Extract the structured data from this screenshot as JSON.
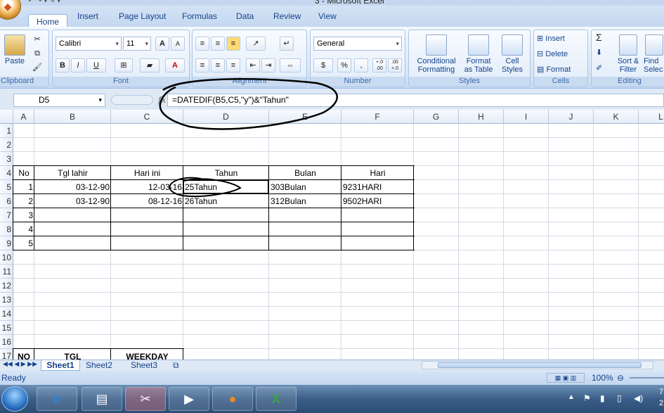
{
  "window": {
    "title": "3 - Microsoft Excel"
  },
  "tabs": [
    "Home",
    "Insert",
    "Page Layout",
    "Formulas",
    "Data",
    "Review",
    "View"
  ],
  "ribbon": {
    "clipboard": {
      "label": "Clipboard",
      "paste": "Paste"
    },
    "font": {
      "label": "Font",
      "name": "Calibri",
      "size": "11",
      "bold": "B",
      "italic": "I",
      "underline": "U",
      "grow": "A",
      "shrink": "A"
    },
    "alignment": {
      "label": "Alignment"
    },
    "number": {
      "label": "Number",
      "format": "General",
      "currency": "$",
      "percent": "%",
      "comma": ",",
      "inc_dec": "+.0 .00",
      "dec_dec": ".00 +.0"
    },
    "styles": {
      "label": "Styles",
      "conditional": "Conditional",
      "conditional2": "Formatting",
      "format_table": "Format",
      "format_table2": "as Table",
      "cell_styles": "Cell",
      "cell_styles2": "Styles"
    },
    "cells": {
      "label": "Cells",
      "insert": "Insert",
      "delete": "Delete",
      "format": "Format"
    },
    "editing": {
      "label": "Editing",
      "sum": "Σ",
      "sort": "Sort &",
      "sort2": "Filter",
      "find": "Find",
      "find2": "Selec"
    }
  },
  "formula_bar": {
    "name_box": "D5",
    "fx": "fx",
    "formula": "=DATEDIF(B5,C5,\"y\")&\"Tahun\""
  },
  "columns": [
    "A",
    "B",
    "C",
    "D",
    "E",
    "F",
    "G",
    "H",
    "I",
    "J",
    "K",
    "L"
  ],
  "rows": [
    "1",
    "2",
    "3",
    "4",
    "5",
    "6",
    "7",
    "8",
    "9",
    "10",
    "11",
    "12",
    "13",
    "14",
    "15",
    "16",
    "17"
  ],
  "table": {
    "headers": [
      "No",
      "Tgl lahir",
      "Hari ini",
      "Tahun",
      "Bulan",
      "Hari"
    ],
    "rows": [
      [
        "1",
        "03-12-90",
        "12-03-16",
        "25Tahun",
        "303Bulan",
        "9231HARI"
      ],
      [
        "2",
        "03-12-90",
        "08-12-16",
        "26Tahun",
        "312Bulan",
        "9502HARI"
      ],
      [
        "3",
        "",
        "",
        "",
        "",
        ""
      ],
      [
        "4",
        "",
        "",
        "",
        "",
        ""
      ],
      [
        "5",
        "",
        "",
        "",
        "",
        ""
      ]
    ]
  },
  "row17": [
    "NO",
    "TGL",
    "WEEKDAY"
  ],
  "sheets": [
    "Sheet1",
    "Sheet2",
    "Sheet3"
  ],
  "status": {
    "text": "Ready",
    "zoom": "100%"
  },
  "taskbar": {
    "clock": "7",
    "clock2": "2"
  }
}
